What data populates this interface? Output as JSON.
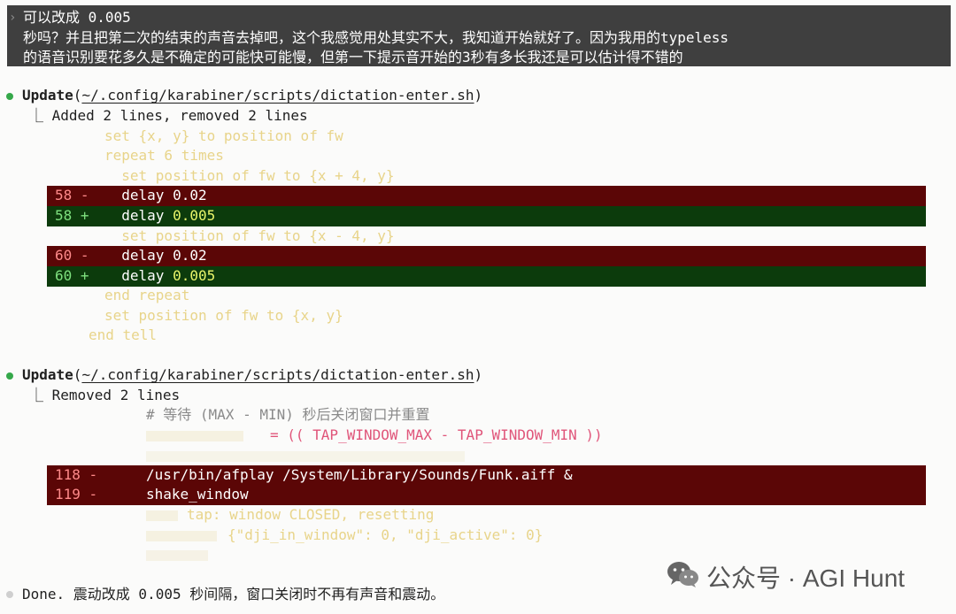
{
  "prompt": {
    "caret": "›",
    "lines": [
      "可以改成 0.005",
      "秒吗？并且把第二次的结束的声音去掉吧，这个我感觉用处其实不大，我知道开始就好了。因为我用的typeless",
      "的语音识别要花多久是不确定的可能快可能慢，但第一下提示音开始的3秒有多长我还是可以估计得不错的"
    ]
  },
  "update1": {
    "action": "Update",
    "path": "~/.config/karabiner/scripts/dictation-enter.sh",
    "summary": "⎿ Added 2 lines, removed 2 lines",
    "rows": [
      {
        "kind": "ctx",
        "text": "set {x, y} to position of fw"
      },
      {
        "kind": "ctx",
        "text": "repeat 6 times"
      },
      {
        "kind": "ctx",
        "text": "  set position of fw to {x + 4, y}"
      },
      {
        "kind": "rem",
        "ln": "58 -",
        "code": "  delay 0.02"
      },
      {
        "kind": "add",
        "ln": "58 +",
        "code": "  delay ",
        "hl": "0.005"
      },
      {
        "kind": "ctx",
        "text": "  set position of fw to {x - 4, y}"
      },
      {
        "kind": "rem",
        "ln": "60 -",
        "code": "  delay 0.02"
      },
      {
        "kind": "add",
        "ln": "60 +",
        "code": "  delay ",
        "hl": "0.005"
      },
      {
        "kind": "ctx",
        "text": "end repeat"
      },
      {
        "kind": "ctx",
        "text": "set position of fw to {x, y}"
      },
      {
        "kind": "ctx",
        "text": "end tell"
      }
    ]
  },
  "update2": {
    "action": "Update",
    "path": "~/.config/karabiner/scripts/dictation-enter.sh",
    "summary": "⎿ Removed 2 lines",
    "comment": "# 等待 (MAX - MIN) 秒后关闭窗口并重置",
    "assign": "= (( TAP_WINDOW_MAX - TAP_WINDOW_MIN ))",
    "rem1_ln": "118 -",
    "rem1_code": "/usr/bin/afplay /System/Library/Sounds/Funk.aiff &",
    "rem2_ln": "119 -",
    "rem2_code": "shake_window",
    "tap_line": "tap: window CLOSED, resetting",
    "json_line": "{\"dji_in_window\": 0, \"dji_active\": 0}"
  },
  "done": "Done. 震动改成 0.005 秒间隔，窗口关闭时不再有声音和震动。",
  "watermark": {
    "text": "公众号 · AGI Hunt",
    "icon": "wechat-icon"
  },
  "colors": {
    "bullet": "#35a84a",
    "removed_bg": "#5b0606",
    "added_bg": "#0c3b0c",
    "context": "#e8d48a"
  }
}
